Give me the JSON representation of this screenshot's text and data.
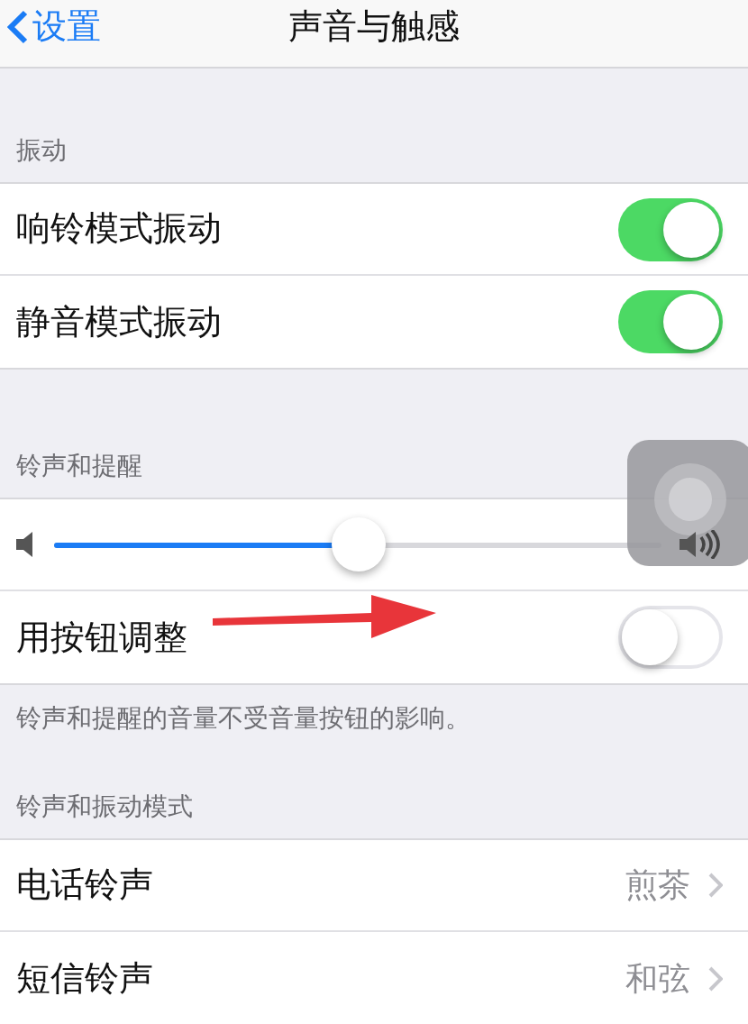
{
  "nav": {
    "back": "设置",
    "title": "声音与触感"
  },
  "sections": [
    {
      "header": "振动",
      "rows": [
        {
          "kind": "toggle",
          "label": "响铃模式振动",
          "on": true
        },
        {
          "kind": "toggle",
          "label": "静音模式振动",
          "on": true
        }
      ]
    },
    {
      "header": "铃声和提醒",
      "rows": [
        {
          "kind": "slider",
          "level": 0.5
        },
        {
          "kind": "toggle",
          "label": "用按钮调整",
          "on": false
        }
      ],
      "footer": "铃声和提醒的音量不受音量按钮的影响。"
    },
    {
      "header": "铃声和振动模式",
      "rows": [
        {
          "kind": "link",
          "label": "电话铃声",
          "value": "煎茶"
        },
        {
          "kind": "link",
          "label": "短信铃声",
          "value": "和弦"
        }
      ]
    }
  ]
}
